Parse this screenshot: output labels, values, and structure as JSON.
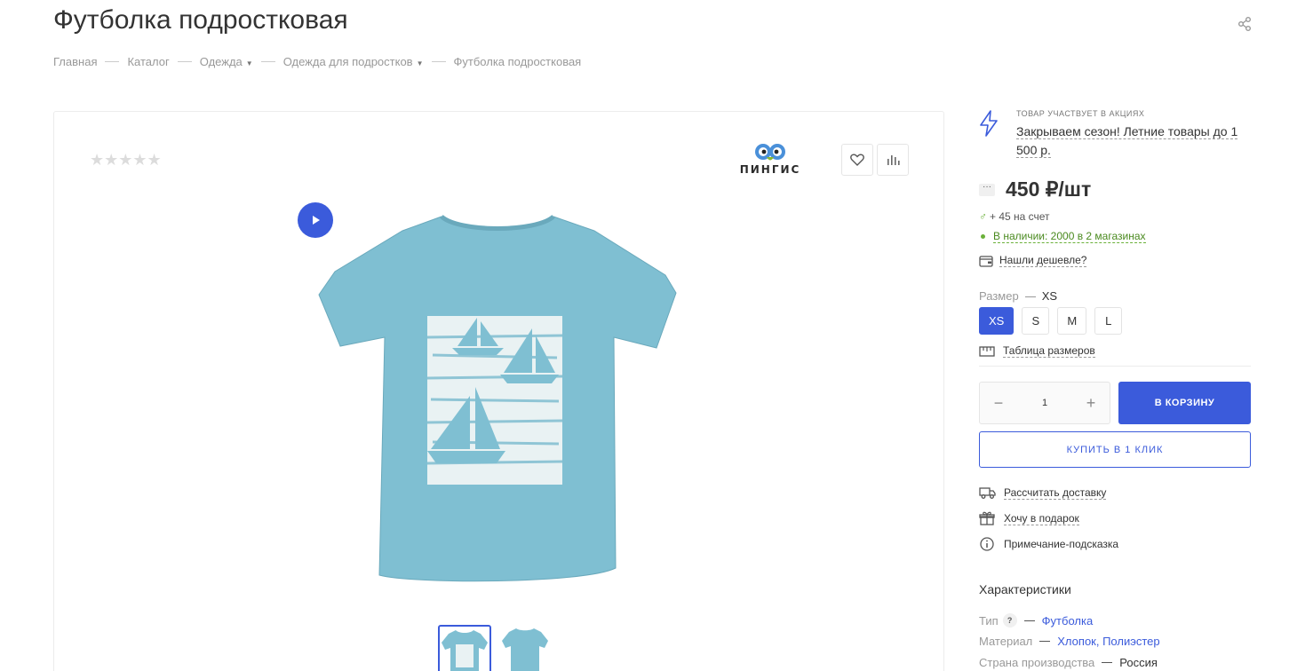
{
  "page": {
    "title": "Футболка подростковая"
  },
  "breadcrumb": [
    {
      "label": "Главная"
    },
    {
      "label": "Каталог"
    },
    {
      "label": "Одежда"
    },
    {
      "label": "Одежда для подростков"
    },
    {
      "label": "Футболка подростковая"
    }
  ],
  "gallery": {
    "rating": {
      "stars": "★★★★★",
      "value": 0,
      "max": 5
    },
    "brand": "ПИНГИС",
    "thumbnails": 2
  },
  "promo": {
    "label": "Товар участвует в акциях",
    "link": "Закрываем сезон! Летние товары до 1 500 р."
  },
  "price": {
    "more": "···",
    "value": "450 ₽/шт"
  },
  "bonus": "+ 45 на счет",
  "stock": {
    "label": "В наличии: 2000 в 2 магазинах"
  },
  "cheaper": "Нашли дешевле?",
  "size": {
    "label": "Размер",
    "current": "XS",
    "options": [
      "XS",
      "S",
      "M",
      "L"
    ],
    "table_link": "Таблица размеров"
  },
  "cart": {
    "quantity": "1",
    "minus": "−",
    "plus": "+",
    "add_label": "В КОРЗИНУ",
    "oneclick_label": "КУПИТЬ В 1 КЛИК"
  },
  "links": {
    "delivery": "Рассчитать доставку",
    "gift": "Хочу в подарок",
    "hint": "Примечание-подсказка"
  },
  "characteristics": {
    "title": "Характеристики",
    "rows": [
      {
        "key": "Тип",
        "value": "Футболка",
        "hint": "?"
      },
      {
        "key": "Материал",
        "value": "Хлопок, Полиэстер"
      },
      {
        "key": "Страна производства",
        "value": "Россия"
      }
    ]
  },
  "colors": {
    "accent": "#3b5bdb",
    "stock_green": "#6bb13a",
    "tshirt": "#7fbfd2"
  },
  "icons": [
    "share-icon",
    "heart-icon",
    "compare-icon",
    "play-icon",
    "lightning-icon",
    "bonus-icon",
    "wallet-icon",
    "ruler-icon",
    "truck-icon",
    "gift-icon",
    "info-icon"
  ]
}
